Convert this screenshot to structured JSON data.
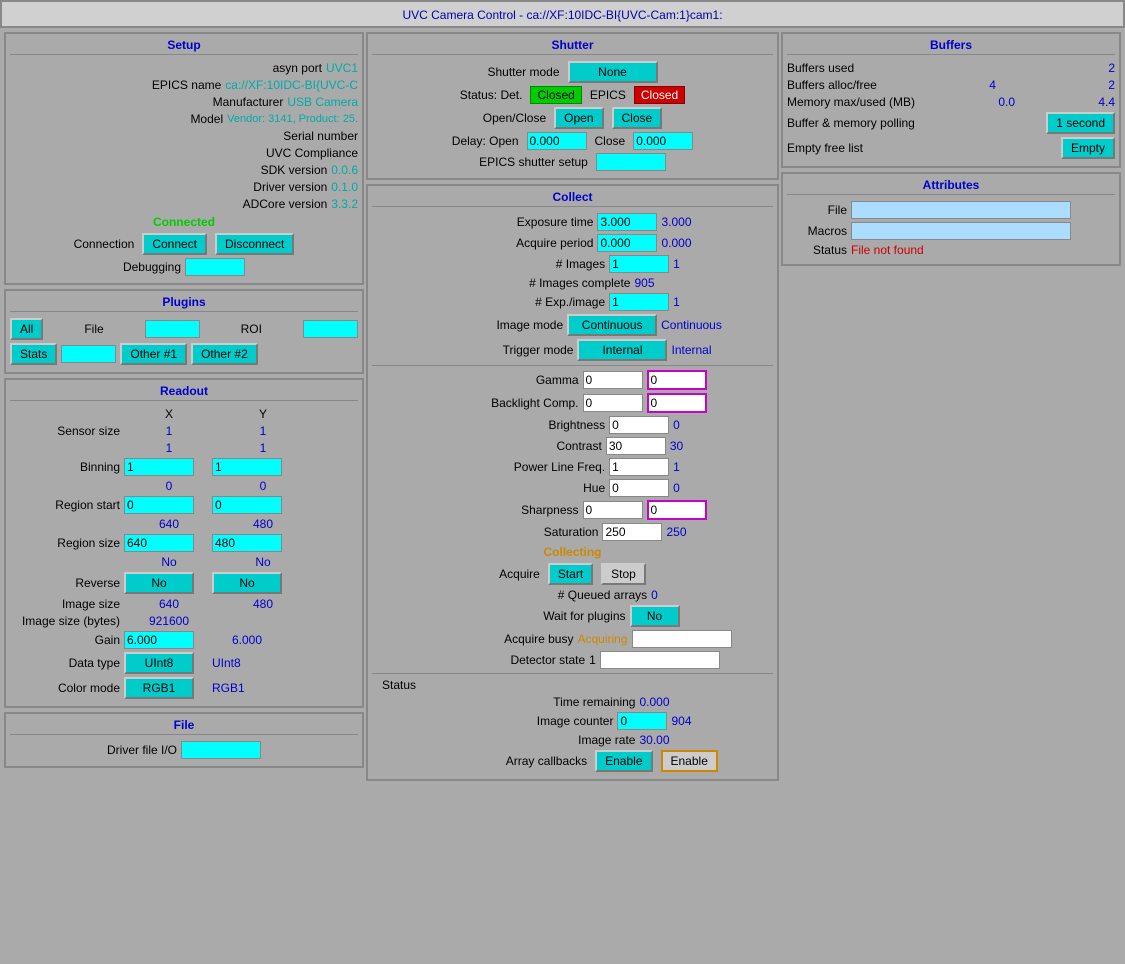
{
  "title": "UVC Camera Control - ca://XF:10IDC-BI{UVC-Cam:1}cam1:",
  "setup": {
    "section_title": "Setup",
    "asyn_port_label": "asyn port",
    "asyn_port_value": "UVC1",
    "epics_name_label": "EPICS name",
    "epics_name_value": "ca://XF:10IDC-BI{UVC-C",
    "manufacturer_label": "Manufacturer",
    "manufacturer_value": "USB Camera",
    "model_label": "Model",
    "model_value": "Vendor: 3141, Product: 25.",
    "serial_number_label": "Serial number",
    "uvc_compliance_label": "UVC Compliance",
    "sdk_version_label": "SDK version",
    "sdk_version_value": "0.0.6",
    "driver_version_label": "Driver version",
    "driver_version_value": "0.1.0",
    "adcore_version_label": "ADCore version",
    "adcore_version_value": "3.3.2",
    "connected_status": "Connected",
    "connection_label": "Connection",
    "connect_btn": "Connect",
    "disconnect_btn": "Disconnect",
    "debugging_label": "Debugging",
    "debugging_value": ""
  },
  "plugins": {
    "section_title": "Plugins",
    "all_btn": "All",
    "file_btn": "File",
    "file_value": "",
    "roi_btn": "ROI",
    "roi_value": "",
    "stats_btn": "Stats",
    "stats_value": "",
    "other1_btn": "Other #1",
    "other2_btn": "Other #2"
  },
  "readout": {
    "section_title": "Readout",
    "x_label": "X",
    "y_label": "Y",
    "sensor_size_label": "Sensor size",
    "sensor_x": "1",
    "sensor_y": "1",
    "binning_val1": "1",
    "binning_val2": "1",
    "binning_label": "Binning",
    "binning_x": "1",
    "binning_y": "1",
    "binning_x_sub": "0",
    "binning_y_sub": "0",
    "region_start_label": "Region start",
    "region_start_x": "0",
    "region_start_y": "0",
    "region_size_label": "Region size",
    "region_size_x_val": "640",
    "region_size_y_val": "480",
    "region_size_x": "640",
    "region_size_y": "480",
    "reverse_label": "Reverse",
    "reverse_x_val": "No",
    "reverse_y_val": "No",
    "reverse_x": "No",
    "reverse_y": "No",
    "image_size_label": "Image size",
    "image_size_x": "640",
    "image_size_y": "480",
    "image_size_bytes_label": "Image size (bytes)",
    "image_size_bytes": "921600",
    "gain_label": "Gain",
    "gain_x": "6.000",
    "gain_y": "6.000",
    "data_type_label": "Data type",
    "data_type_x": "UInt8",
    "data_type_y": "UInt8",
    "color_mode_label": "Color mode",
    "color_mode_x": "RGB1",
    "color_mode_y": "RGB1"
  },
  "file": {
    "section_title": "File",
    "driver_file_io_label": "Driver file I/O",
    "driver_file_io_value": ""
  },
  "shutter": {
    "section_title": "Shutter",
    "shutter_mode_label": "Shutter mode",
    "shutter_mode_value": "None",
    "status_label": "Status: Det.",
    "status_det_value": "Closed",
    "epics_label": "EPICS",
    "epics_value": "Closed",
    "open_close_label": "Open/Close",
    "open_btn": "Open",
    "close_btn": "Close",
    "delay_open_label": "Delay: Open",
    "delay_open_value": "0.000",
    "delay_close_label": "Close",
    "delay_close_value": "0.000",
    "epics_shutter_label": "EPICS shutter setup",
    "epics_shutter_value": ""
  },
  "collect": {
    "section_title": "Collect",
    "exposure_time_label": "Exposure time",
    "exposure_time_input": "3.000",
    "exposure_time_val": "3.000",
    "acquire_period_label": "Acquire period",
    "acquire_period_input": "0.000",
    "acquire_period_val": "0.000",
    "num_images_label": "# Images",
    "num_images_input": "1",
    "num_images_val": "1",
    "num_images_complete_label": "# Images complete",
    "num_images_complete_val": "905",
    "num_exp_image_label": "# Exp./image",
    "num_exp_image_input": "1",
    "num_exp_image_val": "1",
    "image_mode_label": "Image mode",
    "image_mode_input": "Continuous",
    "image_mode_val": "Continuous",
    "trigger_mode_label": "Trigger mode",
    "trigger_mode_input": "Internal",
    "trigger_mode_val": "Internal",
    "gamma_label": "Gamma",
    "gamma_input": "0",
    "gamma_val": "0",
    "backlight_label": "Backlight Comp.",
    "backlight_input": "0",
    "backlight_val": "0",
    "brightness_label": "Brightness",
    "brightness_input": "0",
    "brightness_val": "0",
    "contrast_label": "Contrast",
    "contrast_input": "30",
    "contrast_val": "30",
    "power_line_label": "Power Line Freq.",
    "power_line_input": "1",
    "power_line_val": "1",
    "hue_label": "Hue",
    "hue_input": "0",
    "hue_val": "0",
    "sharpness_label": "Sharpness",
    "sharpness_input": "0",
    "sharpness_val": "0",
    "saturation_label": "Saturation",
    "saturation_input": "250",
    "saturation_val": "250",
    "collecting_status": "Collecting",
    "acquire_label": "Acquire",
    "start_btn": "Start",
    "stop_btn": "Stop",
    "queued_arrays_label": "# Queued arrays",
    "queued_arrays_val": "0",
    "wait_plugins_label": "Wait for plugins",
    "wait_plugins_val": "No",
    "acquire_busy_label": "Acquire busy",
    "acquire_busy_val": "Acquiring",
    "detector_state_label": "Detector state",
    "detector_state_val": "1",
    "status_label": "Status",
    "time_remaining_label": "Time remaining",
    "time_remaining_val": "0.000",
    "image_counter_label": "Image counter",
    "image_counter_input": "0",
    "image_counter_val": "904",
    "image_rate_label": "Image rate",
    "image_rate_val": "30.00",
    "array_callbacks_label": "Array callbacks",
    "array_callbacks_btn": "Enable",
    "array_callbacks_val": "Enable"
  },
  "buffers": {
    "section_title": "Buffers",
    "buffers_used_label": "Buffers used",
    "buffers_used_val": "2",
    "buffers_alloc_label": "Buffers alloc/free",
    "buffers_alloc_val1": "4",
    "buffers_alloc_val2": "2",
    "memory_label": "Memory max/used (MB)",
    "memory_val1": "0.0",
    "memory_val2": "4.4",
    "polling_label": "Buffer & memory polling",
    "polling_val": "1 second",
    "empty_list_label": "Empty free list",
    "empty_btn": "Empty"
  },
  "attributes": {
    "section_title": "Attributes",
    "file_label": "File",
    "file_value": "",
    "macros_label": "Macros",
    "macros_value": "",
    "status_label": "Status",
    "status_value": "File not found"
  }
}
